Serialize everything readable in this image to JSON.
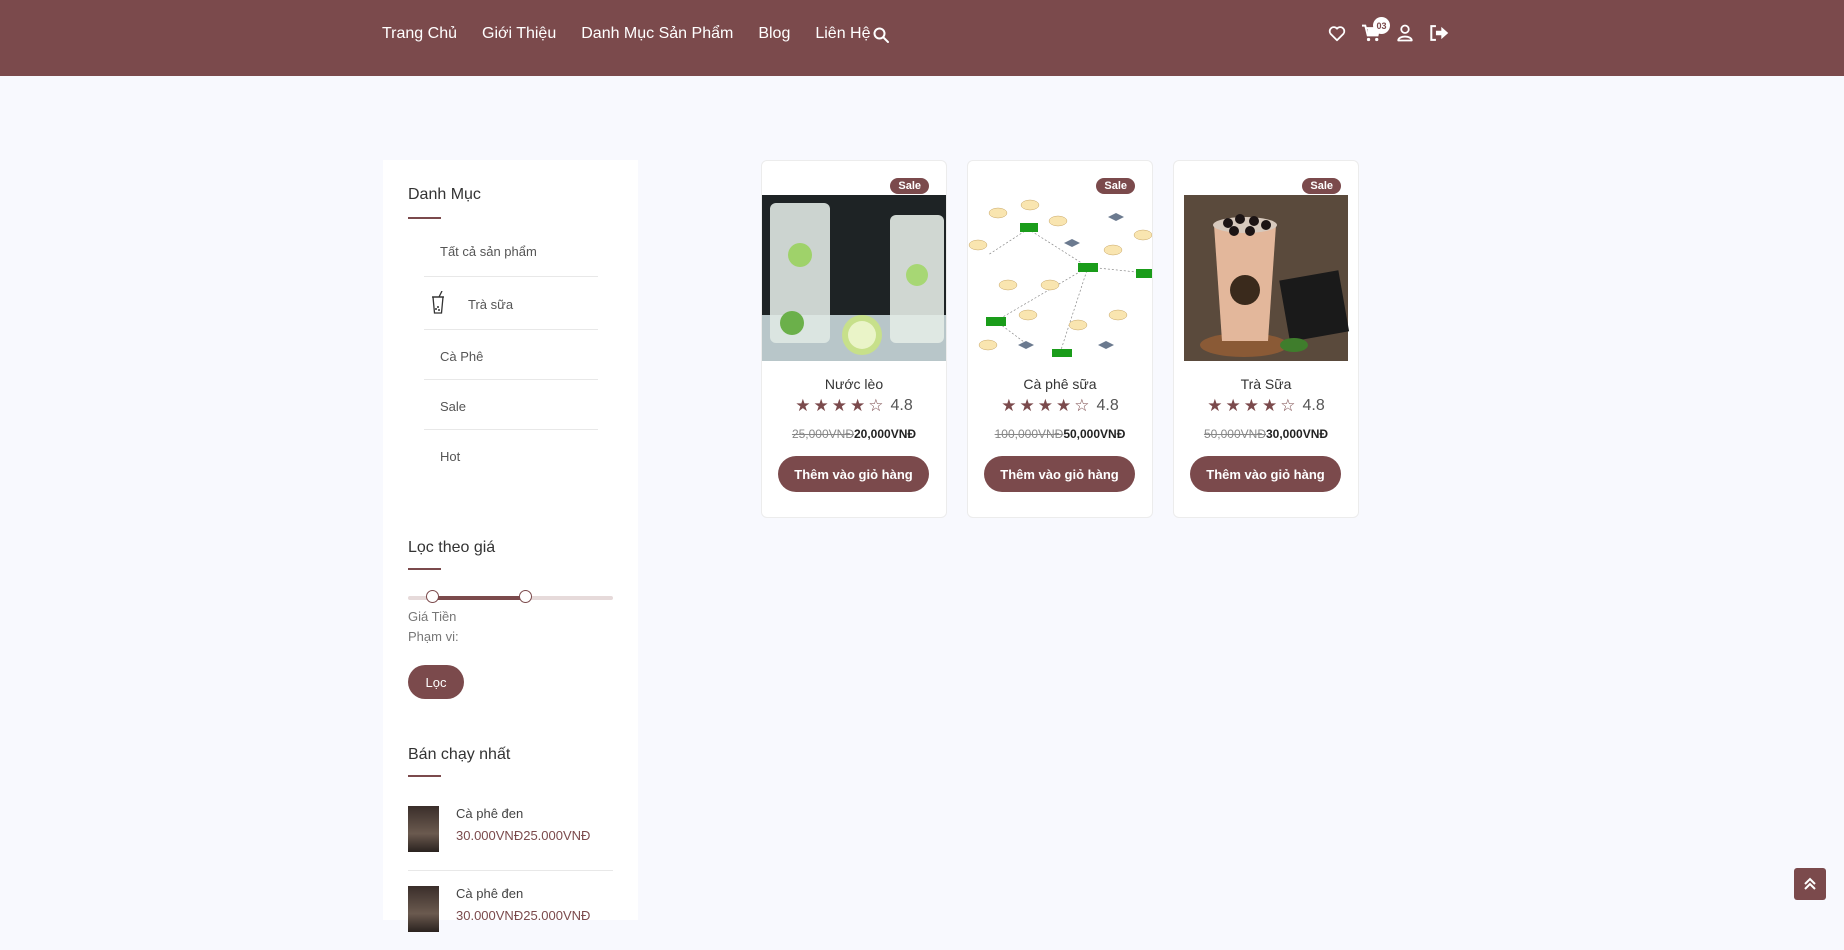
{
  "nav": {
    "items": [
      "Trang Chủ",
      "Giới Thiệu",
      "Danh Mục Sản Phẩm",
      "Blog",
      "Liên Hệ"
    ],
    "cart_count": "03"
  },
  "sidebar": {
    "category_title": "Danh Mục",
    "categories": [
      "Tất cả sản phẩm",
      "Trà sữa",
      "Cà Phê",
      "Sale",
      "Hot"
    ],
    "filter_title": "Lọc theo giá",
    "price_label": "Giá Tiền",
    "range_label": "Phạm vi:",
    "filter_button": "Lọc",
    "bestseller_title": "Bán chạy nhất",
    "bestsellers": [
      {
        "name": "Cà phê đen",
        "old_price": "30.000VNĐ",
        "price": "25.000VNĐ"
      },
      {
        "name": "Cà phê đen",
        "old_price": "30.000VNĐ",
        "price": "25.000VNĐ"
      }
    ]
  },
  "products": [
    {
      "badge": "Sale",
      "name": "Nước lèo",
      "rating": "4.8",
      "old_price": "25,000VNĐ",
      "price": "20,000VNĐ",
      "button": "Thêm vào giỏ hàng"
    },
    {
      "badge": "Sale",
      "name": "Cà phê sữa",
      "rating": "4.8",
      "old_price": "100,000VNĐ",
      "price": "50,000VNĐ",
      "button": "Thêm vào giỏ hàng"
    },
    {
      "badge": "Sale",
      "name": "Trà Sữa",
      "rating": "4.8",
      "old_price": "50,000VNĐ",
      "price": "30,000VNĐ",
      "button": "Thêm vào giỏ hàng"
    }
  ],
  "colors": {
    "brand": "#7b4a4c",
    "background": "#f8f9fe"
  }
}
